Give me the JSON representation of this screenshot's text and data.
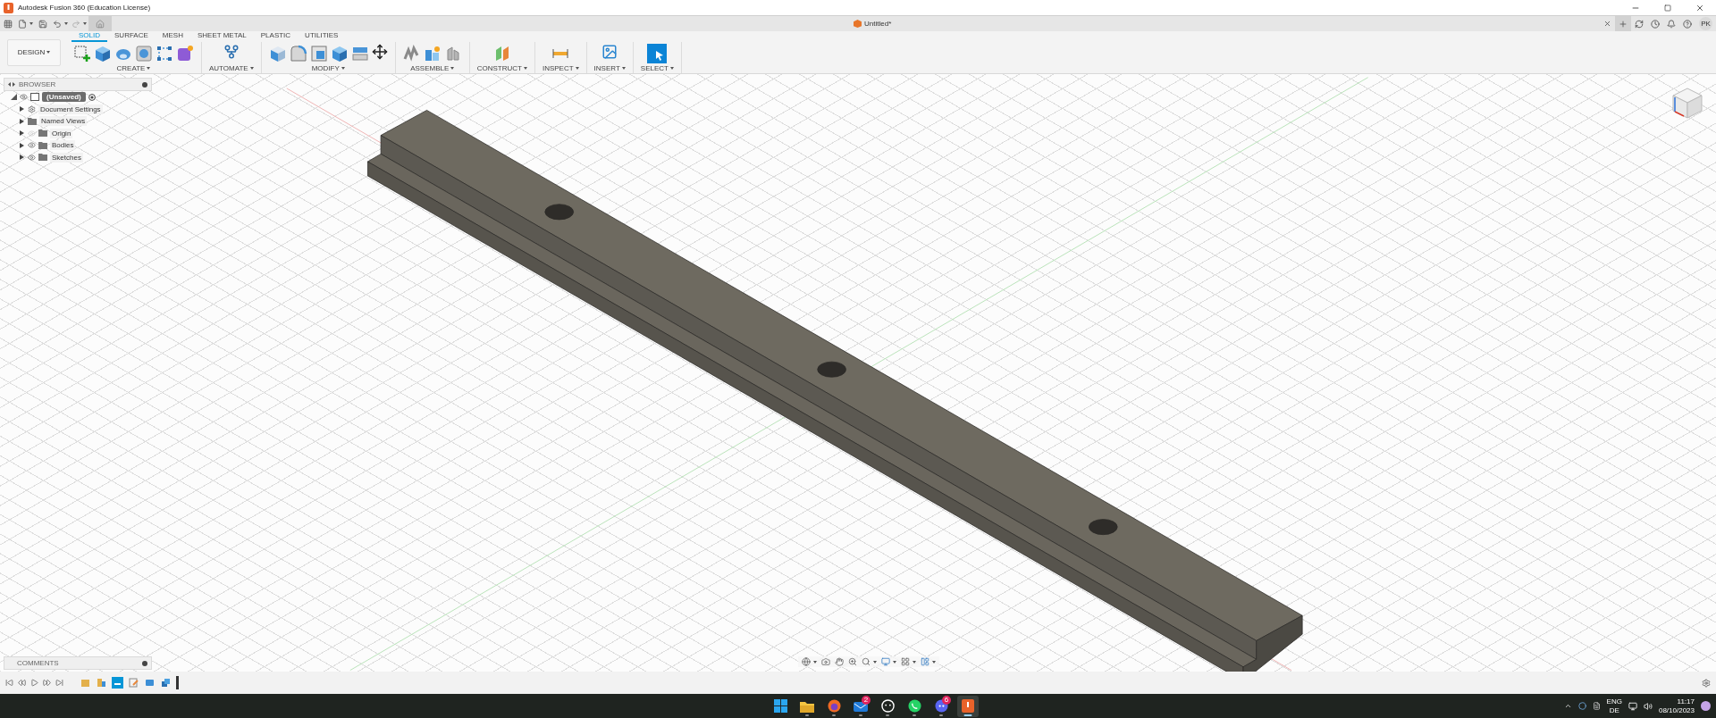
{
  "window": {
    "title": "Autodesk Fusion 360 (Education License)"
  },
  "document_tab": {
    "title": "Untitled*"
  },
  "user": {
    "initials": "PK"
  },
  "workspace": {
    "label": "DESIGN"
  },
  "tabs": [
    {
      "label": "SOLID",
      "selected": true
    },
    {
      "label": "SURFACE",
      "selected": false
    },
    {
      "label": "MESH",
      "selected": false
    },
    {
      "label": "SHEET METAL",
      "selected": false
    },
    {
      "label": "PLASTIC",
      "selected": false
    },
    {
      "label": "UTILITIES",
      "selected": false
    }
  ],
  "tool_groups": [
    {
      "label": "CREATE"
    },
    {
      "label": "AUTOMATE"
    },
    {
      "label": "MODIFY"
    },
    {
      "label": "ASSEMBLE"
    },
    {
      "label": "CONSTRUCT"
    },
    {
      "label": "INSPECT"
    },
    {
      "label": "INSERT"
    },
    {
      "label": "SELECT"
    }
  ],
  "browser": {
    "title": "BROWSER",
    "root": {
      "label": "(Unsaved)",
      "children": [
        {
          "label": "Document Settings",
          "kind": "settings"
        },
        {
          "label": "Named Views",
          "kind": "views"
        },
        {
          "label": "Origin",
          "kind": "folder",
          "visible": false
        },
        {
          "label": "Bodies",
          "kind": "folder",
          "visible": true
        },
        {
          "label": "Sketches",
          "kind": "folder",
          "visible": true
        }
      ]
    }
  },
  "comments": {
    "title": "COMMENTS"
  },
  "timeline": {
    "features": [
      {
        "kind": "component",
        "selected": false
      },
      {
        "kind": "joint",
        "selected": false
      },
      {
        "kind": "sketch",
        "selected": true
      },
      {
        "kind": "edit",
        "selected": false
      },
      {
        "kind": "extrude",
        "selected": false
      },
      {
        "kind": "combine",
        "selected": false
      }
    ]
  },
  "taskbar": {
    "apps": [
      {
        "kind": "start",
        "active": false
      },
      {
        "kind": "explorer",
        "active": false
      },
      {
        "kind": "firefox",
        "active": false
      },
      {
        "kind": "mail",
        "active": false,
        "badge": "2"
      },
      {
        "kind": "steam",
        "active": false
      },
      {
        "kind": "whatsapp",
        "active": false
      },
      {
        "kind": "discord",
        "active": false,
        "badge": "6"
      },
      {
        "kind": "fusion",
        "active": true
      }
    ],
    "tray": {
      "language": "ENG",
      "layout": "DE",
      "time": "11:17",
      "date": "08/10/2023"
    }
  }
}
